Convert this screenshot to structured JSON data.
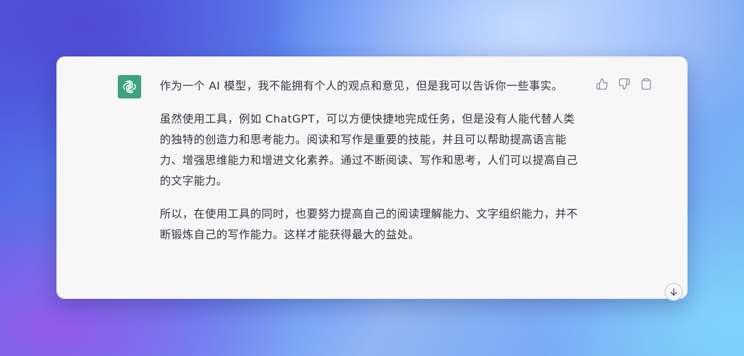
{
  "message": {
    "avatar_icon": "openai-logo-icon",
    "avatar_color": "#3ea37f",
    "paragraphs": [
      "作为一个 AI 模型，我不能拥有个人的观点和意见，但是我可以告诉你一些事实。",
      "虽然使用工具，例如 ChatGPT，可以方便快捷地完成任务，但是没有人能代替人类的独特的创造力和思考能力。阅读和写作是重要的技能，并且可以帮助提高语言能力、增强思维能力和增进文化素养。通过不断阅读、写作和思考，人们可以提高自己的文字能力。",
      "所以，在使用工具的同时，也要努力提高自己的阅读理解能力、文字组织能力，并不断锻炼自己的写作能力。这样才能获得最大的益处。"
    ]
  },
  "actions": {
    "icons": [
      "thumbs-up-icon",
      "thumbs-down-icon",
      "clipboard-icon"
    ]
  },
  "scroll": {
    "icon": "arrow-down-icon"
  }
}
